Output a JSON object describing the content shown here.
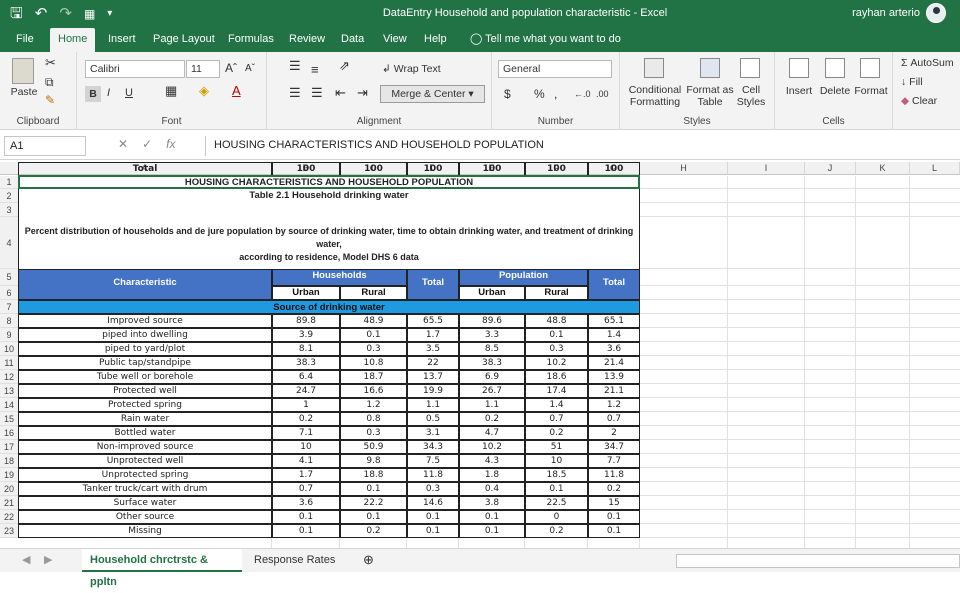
{
  "window": {
    "title": "DataEntry Household and population characteristic  -  Excel",
    "user": "rayhan arterio"
  },
  "qat": {
    "save_icon": "save-icon",
    "undo_icon": "undo-icon",
    "redo_icon": "redo-icon",
    "form_icon": "form-icon",
    "customize_icon": "customize-qat-icon"
  },
  "tabs": [
    "File",
    "Home",
    "Insert",
    "Page Layout",
    "Formulas",
    "Review",
    "Data",
    "View",
    "Help"
  ],
  "tell_me": "Tell me what you want to do",
  "ribbon": {
    "clipboard": {
      "paste": "Paste",
      "label": "Clipboard"
    },
    "font": {
      "name": "Calibri",
      "size": "11",
      "label": "Font",
      "bold": "B",
      "italic": "I",
      "underline": "U"
    },
    "alignment": {
      "wrap": "Wrap Text",
      "merge": "Merge & Center",
      "label": "Alignment"
    },
    "number": {
      "format": "General",
      "label": "Number",
      "currency": "$",
      "percent": "%",
      "comma": ","
    },
    "styles": {
      "conditional": "Conditional",
      "conditional2": "Formatting",
      "format_as": "Format as",
      "format_as2": "Table",
      "cell": "Cell",
      "cell2": "Styles",
      "label": "Styles"
    },
    "cells": {
      "insert": "Insert",
      "delete": "Delete",
      "format": "Format",
      "label": "Cells"
    },
    "editing": {
      "autosum": "AutoSum",
      "fill": "Fill",
      "clear": "Clear"
    }
  },
  "formula_bar": {
    "name_box": "A1",
    "fx": "fx",
    "content": "HOUSING CHARACTERISTICS AND HOUSEHOLD POPULATION"
  },
  "columns": [
    "A",
    "B",
    "C",
    "D",
    "E",
    "F",
    "G",
    "H",
    "I",
    "J",
    "K",
    "L"
  ],
  "rows": [
    "1",
    "2",
    "3",
    "4",
    "5",
    "6",
    "7",
    "8",
    "9",
    "10",
    "11",
    "12",
    "13",
    "14",
    "15",
    "16",
    "17",
    "18",
    "19",
    "20",
    "21",
    "22",
    "23"
  ],
  "sheet": {
    "title": "HOUSING CHARACTERISTICS AND HOUSEHOLD POPULATION",
    "subtitle": "Table 2.1 Household drinking water",
    "description": "Percent distribution of households and de jure population by source of drinking water, time to obtain drinking water, and treatment of drinking water,",
    "description2": "according to residence, Model DHS 6 data",
    "characteristic": "Characteristic",
    "households": "Households",
    "population": "Population",
    "total": "Total",
    "urban": "Urban",
    "rural": "Rural",
    "section": "Source of drinking water",
    "data": [
      [
        "Improved source",
        "89.8",
        "48.9",
        "65.5",
        "89.6",
        "48.8",
        "65.1"
      ],
      [
        "piped into dwelling",
        "3.9",
        "0.1",
        "1.7",
        "3.3",
        "0.1",
        "1.4"
      ],
      [
        "piped to yard/plot",
        "8.1",
        "0.3",
        "3.5",
        "8.5",
        "0.3",
        "3.6"
      ],
      [
        "Public tap/standpipe",
        "38.3",
        "10.8",
        "22",
        "38.3",
        "10.2",
        "21.4"
      ],
      [
        "Tube well or borehole",
        "6.4",
        "18.7",
        "13.7",
        "6.9",
        "18.6",
        "13.9"
      ],
      [
        "Protected well",
        "24.7",
        "16.6",
        "19.9",
        "26.7",
        "17.4",
        "21.1"
      ],
      [
        "Protected spring",
        "1",
        "1.2",
        "1.1",
        "1.1",
        "1.4",
        "1.2"
      ],
      [
        "Rain water",
        "0.2",
        "0.8",
        "0.5",
        "0.2",
        "0.7",
        "0.7"
      ],
      [
        "Bottled water",
        "7.1",
        "0.3",
        "3.1",
        "4.7",
        "0.2",
        "2"
      ],
      [
        "Non-improved source",
        "10",
        "50.9",
        "34.3",
        "10.2",
        "51",
        "34.7"
      ],
      [
        "Unprotected well",
        "4.1",
        "9.8",
        "7.5",
        "4.3",
        "10",
        "7.7"
      ],
      [
        "Unprotected spring",
        "1.7",
        "18.8",
        "11.8",
        "1.8",
        "18.5",
        "11.8"
      ],
      [
        "Tanker truck/cart with drum",
        "0.7",
        "0.1",
        "0.3",
        "0.4",
        "0.1",
        "0.2"
      ],
      [
        "Surface water",
        "3.6",
        "22.2",
        "14.6",
        "3.8",
        "22.5",
        "15"
      ],
      [
        "Other source",
        "0.1",
        "0.1",
        "0.1",
        "0.1",
        "0",
        "0.1"
      ],
      [
        "Missing",
        "0.1",
        "0.2",
        "0.1",
        "0.1",
        "0.2",
        "0.1"
      ],
      [
        "Total",
        "100",
        "100",
        "100",
        "100",
        "100",
        "100"
      ]
    ]
  },
  "sheet_tabs": [
    "Household chrctrstc & ppltn",
    "Response Rates"
  ],
  "add_sheet_icon": "plus-circle-icon"
}
